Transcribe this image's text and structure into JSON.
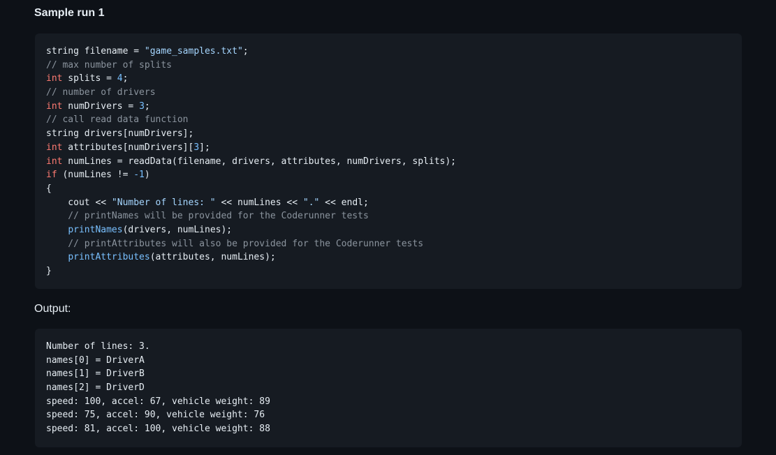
{
  "section_title": "Sample run 1",
  "output_title": "Output:",
  "code": {
    "lines": [
      [
        {
          "t": "string filename = "
        },
        {
          "t": "\"game_samples.txt\"",
          "c": "str"
        },
        {
          "t": ";"
        }
      ],
      [
        {
          "t": "// max number of splits",
          "c": "cmt"
        }
      ],
      [
        {
          "t": "int",
          "c": "kw"
        },
        {
          "t": " splits = "
        },
        {
          "t": "4",
          "c": "num"
        },
        {
          "t": ";"
        }
      ],
      [
        {
          "t": "// number of drivers",
          "c": "cmt"
        }
      ],
      [
        {
          "t": "int",
          "c": "kw"
        },
        {
          "t": " numDrivers = "
        },
        {
          "t": "3",
          "c": "num"
        },
        {
          "t": ";"
        }
      ],
      [
        {
          "t": "// call read data function",
          "c": "cmt"
        }
      ],
      [
        {
          "t": "string drivers[numDrivers];"
        }
      ],
      [
        {
          "t": "int",
          "c": "kw"
        },
        {
          "t": " attributes[numDrivers]["
        },
        {
          "t": "3",
          "c": "num"
        },
        {
          "t": "];"
        }
      ],
      [
        {
          "t": "int",
          "c": "kw"
        },
        {
          "t": " numLines = readData(filename, drivers, attributes, numDrivers, splits);"
        }
      ],
      [
        {
          "t": "if",
          "c": "kw"
        },
        {
          "t": " (numLines != "
        },
        {
          "t": "-1",
          "c": "num"
        },
        {
          "t": ")"
        }
      ],
      [
        {
          "t": "{"
        }
      ],
      [
        {
          "t": "    cout << "
        },
        {
          "t": "\"Number of lines: \"",
          "c": "str"
        },
        {
          "t": " << numLines << "
        },
        {
          "t": "\".\"",
          "c": "str"
        },
        {
          "t": " << endl;"
        }
      ],
      [
        {
          "t": "    // printNames will be provided for the Coderunner tests",
          "c": "cmt"
        }
      ],
      [
        {
          "t": "    "
        },
        {
          "t": "printNames",
          "c": "fn"
        },
        {
          "t": "(drivers, numLines);"
        }
      ],
      [
        {
          "t": "    // printAttributes will also be provided for the Coderunner tests",
          "c": "cmt"
        }
      ],
      [
        {
          "t": "    "
        },
        {
          "t": "printAttributes",
          "c": "fn"
        },
        {
          "t": "(attributes, numLines);"
        }
      ],
      [
        {
          "t": "}"
        }
      ]
    ]
  },
  "output": {
    "lines": [
      "Number of lines: 3.",
      "names[0] = DriverA",
      "names[1] = DriverB",
      "names[2] = DriverD",
      "speed: 100, accel: 67, vehicle weight: 89",
      "speed: 75, accel: 90, vehicle weight: 76",
      "speed: 81, accel: 100, vehicle weight: 88"
    ]
  },
  "colors": {
    "background": "#0d1117",
    "code_background": "#161b22",
    "keyword": "#ff7b72",
    "string": "#a5d6ff",
    "number": "#79c0ff",
    "comment": "#8b949e"
  }
}
